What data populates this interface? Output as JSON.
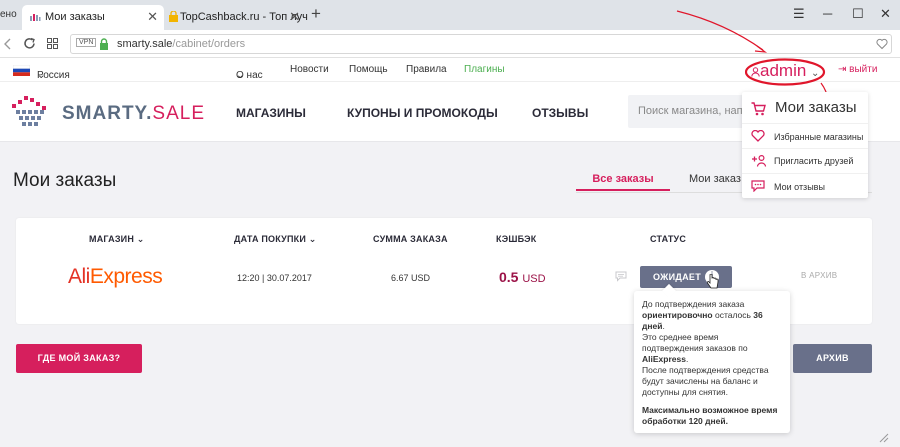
{
  "browser": {
    "prev_tab_fragment": "ено",
    "active_tab": {
      "title": "Мои заказы"
    },
    "inactive_tab": {
      "title": "TopCashback.ru - Топ луч"
    },
    "new_tab_symbol": "+",
    "url_host": "smarty.sale",
    "url_path": "/cabinet/orders",
    "window_controls": [
      "☰",
      "─",
      "☐",
      "✕"
    ]
  },
  "topbar": {
    "country": "Россия",
    "links": [
      "О нас",
      "Новости",
      "Помощь",
      "Правила",
      "Плагины"
    ],
    "user": "admin",
    "logout": "выйти"
  },
  "header": {
    "logo_main": "SMARTY.",
    "logo_accent": "SALE",
    "nav": [
      "МАГАЗИНЫ",
      "КУПОНЫ И ПРОМОКОДЫ",
      "ОТЗЫВЫ"
    ],
    "search_placeholder": "Поиск магазина, напр"
  },
  "page": {
    "title": "Мои заказы",
    "tabs": [
      "Все заказы",
      "Мои заказ"
    ]
  },
  "table": {
    "headers": {
      "shop": "МАГАЗИН",
      "date": "ДАТА ПОКУПКИ",
      "sum": "СУММА ЗАКАЗА",
      "cashback": "КЭШБЭК",
      "status": "СТАТУС"
    },
    "rows": [
      {
        "shop_part1": "Ali",
        "shop_part2": "Express",
        "date": "12:20 | 30.07.2017",
        "sum": "6.67 USD",
        "cashback_value": "0.5",
        "cashback_currency": "USD",
        "status": "ОЖИДАЕТ",
        "archive": "В АРХИВ"
      }
    ]
  },
  "tooltip": {
    "l1": "До подтверждения заказа",
    "l2_bold": "ориентировочно",
    "l2_rest": " осталось ",
    "l2_days": "36",
    "l3_bold": "дней",
    "l3_rest": ".",
    "l4": "Это среднее время",
    "l5": "подтверждения заказов по",
    "l6_bold": "AliExpress",
    "l6_rest": ".",
    "l7": "После подтверждения средства",
    "l8": "будут зачислены на баланс и",
    "l9": "доступны для снятия.",
    "l10": "Максимально возможное время",
    "l11": "обработки 120 дней."
  },
  "buttons": {
    "where_order": "ГДЕ МОЙ ЗАКАЗ?",
    "archive": "АРХИВ"
  },
  "dropdown": {
    "items": [
      "Мои заказы",
      "Избранные магазины",
      "Пригласить друзей",
      "Мои отзывы"
    ]
  },
  "colors": {
    "brand": "#d61f5d",
    "status": "#69708a",
    "annotation_red": "#e0162b"
  }
}
